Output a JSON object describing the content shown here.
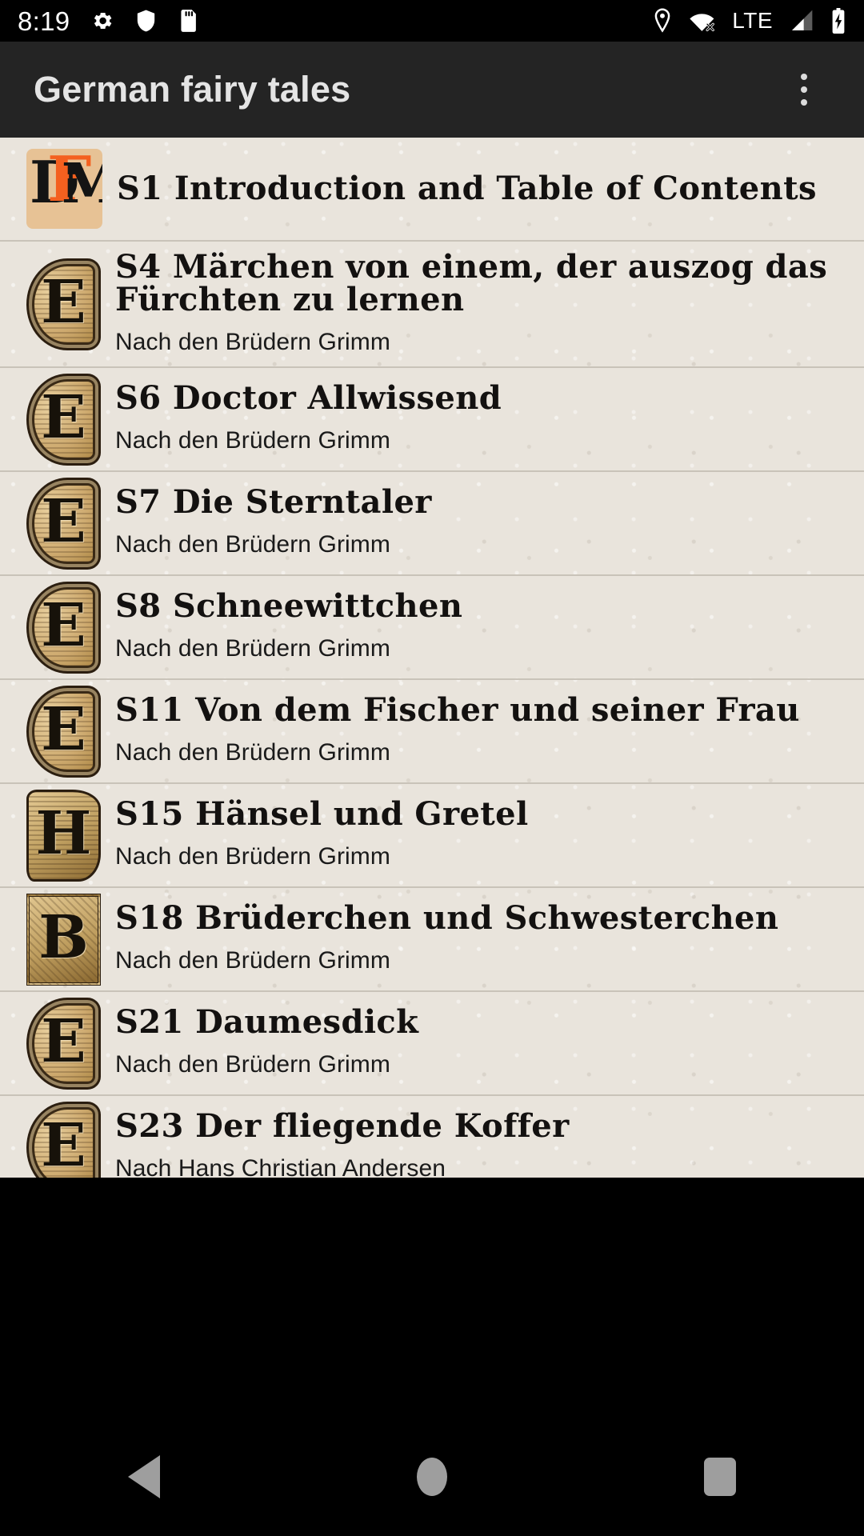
{
  "status_bar": {
    "time": "8:19",
    "left_icons": [
      "gear-icon",
      "shield-icon",
      "sd-card-icon"
    ],
    "right_icons": [
      "location-pin-icon",
      "wifi-off-icon",
      "signal-icon",
      "battery-charging-icon"
    ],
    "network_label": "LTE"
  },
  "app_bar": {
    "title": "German fairy tales",
    "overflow_label": "More options"
  },
  "list": {
    "items": [
      {
        "title": "S1 Introduction and Table of Contents",
        "subtitle": "",
        "thumb_kind": "cover",
        "thumb_glyph": "FM",
        "thumb_name": "book-cover-thumbnail"
      },
      {
        "title": "S4 Märchen von einem, der auszog das Fürchten zu lernen",
        "subtitle": "Nach den Brüdern Grimm",
        "thumb_kind": "round",
        "thumb_glyph": "E",
        "thumb_name": "initial-letter-thumbnail"
      },
      {
        "title": "S6 Doctor Allwissend",
        "subtitle": "Nach den Brüdern Grimm",
        "thumb_kind": "round",
        "thumb_glyph": "E",
        "thumb_name": "initial-letter-thumbnail"
      },
      {
        "title": "S7 Die Sterntaler",
        "subtitle": "Nach den Brüdern Grimm",
        "thumb_kind": "round",
        "thumb_glyph": "E",
        "thumb_name": "initial-letter-thumbnail"
      },
      {
        "title": "S8 Schneewittchen",
        "subtitle": "Nach den Brüdern Grimm",
        "thumb_kind": "round",
        "thumb_glyph": "E",
        "thumb_name": "initial-letter-thumbnail"
      },
      {
        "title": "S11 Von dem Fischer und seiner Frau",
        "subtitle": "Nach den Brüdern Grimm",
        "thumb_kind": "round",
        "thumb_glyph": "E",
        "thumb_name": "initial-letter-thumbnail"
      },
      {
        "title": "S15 Hänsel und Gretel",
        "subtitle": "Nach den Brüdern Grimm",
        "thumb_kind": "shield",
        "thumb_glyph": "H",
        "thumb_name": "initial-letter-thumbnail"
      },
      {
        "title": "S18 Brüderchen und Schwesterchen",
        "subtitle": "Nach den Brüdern Grimm",
        "thumb_kind": "block",
        "thumb_glyph": "B",
        "thumb_name": "initial-letter-thumbnail"
      },
      {
        "title": "S21 Daumesdick",
        "subtitle": "Nach den Brüdern Grimm",
        "thumb_kind": "round",
        "thumb_glyph": "E",
        "thumb_name": "initial-letter-thumbnail"
      },
      {
        "title": "S23 Der fliegende Koffer",
        "subtitle": "Nach Hans Christian Andersen",
        "thumb_kind": "round",
        "thumb_glyph": "E",
        "thumb_name": "initial-letter-thumbnail"
      }
    ]
  },
  "nav_bar": {
    "buttons": [
      "back-button",
      "home-button",
      "recents-button"
    ]
  },
  "colors": {
    "status_bar_bg": "#000000",
    "app_bar_bg": "#242424",
    "app_bar_text": "#e4e4e4",
    "paper_bg": "#e9e4dc",
    "divider": "#c9c3b9",
    "title_text": "#131110",
    "subtitle_text": "#1a1a1a",
    "cover_accent": "#f4601f",
    "cover_bg": "#e7c295",
    "nav_icon": "#9e9e9e"
  }
}
